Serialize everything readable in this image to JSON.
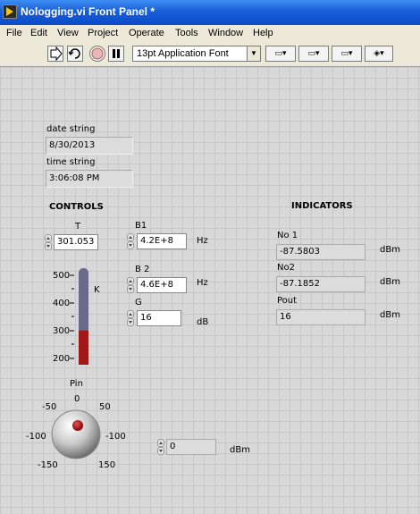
{
  "window": {
    "title": "Nologging.vi Front Panel *"
  },
  "menu": [
    "File",
    "Edit",
    "View",
    "Project",
    "Operate",
    "Tools",
    "Window",
    "Help"
  ],
  "toolbar": {
    "font": "13pt Application Font"
  },
  "panel": {
    "date_label": "date string",
    "date_value": "8/30/2013",
    "time_label": "time string",
    "time_value": "3:06:08 PM",
    "controls_heading": "CONTROLS",
    "indicators_heading": "INDICATORS"
  },
  "controls": {
    "T": {
      "label": "T",
      "value": "301.053"
    },
    "B1": {
      "label": "B1",
      "value": "4.2E+8",
      "unit": "Hz"
    },
    "B2": {
      "label": "B 2",
      "value": "4.6E+8",
      "unit": "Hz"
    },
    "G": {
      "label": "G",
      "value": "16",
      "unit": "dB"
    },
    "pin_value": {
      "value": "0",
      "unit": "dBm"
    }
  },
  "thermometer": {
    "unit": "K",
    "scale": [
      "500",
      "400",
      "300",
      "200"
    ],
    "min": 200,
    "max": 500,
    "value": 301.053,
    "fill_color": "#a01818",
    "tube_color": "#6a6a8a"
  },
  "knob": {
    "label": "Pin",
    "scale": {
      "top": "0",
      "ul": "-50",
      "ur": "50",
      "l": "-100",
      "r": "-100",
      "ll": "-150",
      "lr": "150"
    }
  },
  "indicators": {
    "No1": {
      "label": "No 1",
      "value": "-87.5803",
      "unit": "dBm"
    },
    "No2": {
      "label": "No2",
      "value": "-87.1852",
      "unit": "dBm"
    },
    "Pout": {
      "label": "Pout",
      "value": "16",
      "unit": "dBm"
    }
  }
}
